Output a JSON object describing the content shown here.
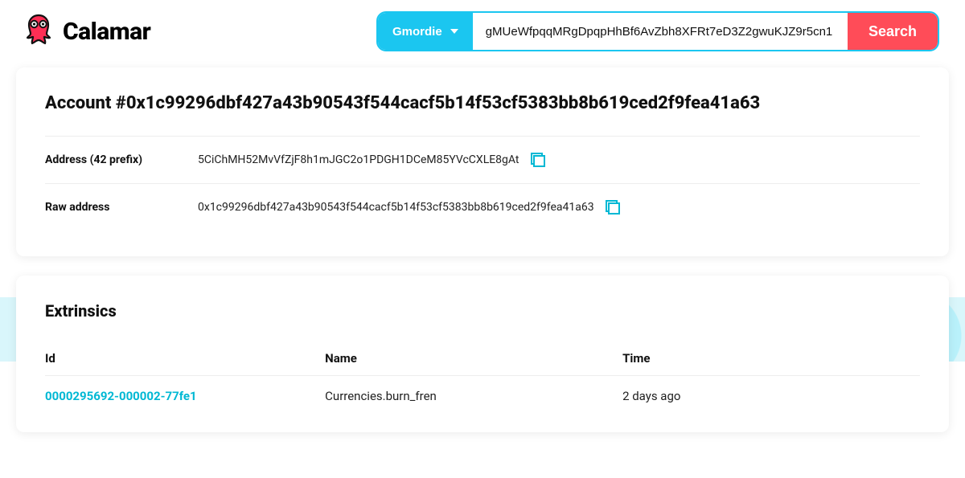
{
  "brand": {
    "name": "Calamar"
  },
  "search": {
    "network_label": "Gmordie",
    "value": "gMUeWfpqqMRgDpqpHhBf6AvZbh8XFRt7eD3Z2gwuKJZ9r5cn1",
    "button_label": "Search"
  },
  "account": {
    "title_prefix": "Account #",
    "id": "0x1c99296dbf427a43b90543f544cacf5b14f53cf5383bb8b619ced2f9fea41a63",
    "rows": {
      "address42": {
        "label": "Address (42 prefix)",
        "value": "5CiChMH52MvVfZjF8h1mJGC2o1PDGH1DCeM85YVcCXLE8gAt"
      },
      "raw": {
        "label": "Raw address",
        "value": "0x1c99296dbf427a43b90543f544cacf5b14f53cf5383bb8b619ced2f9fea41a63"
      }
    }
  },
  "extrinsics": {
    "title": "Extrinsics",
    "columns": {
      "id": "Id",
      "name": "Name",
      "time": "Time"
    },
    "rows": [
      {
        "id": "0000295692-000002-77fe1",
        "name": "Currencies.burn_fren",
        "time": "2 days ago"
      }
    ]
  }
}
